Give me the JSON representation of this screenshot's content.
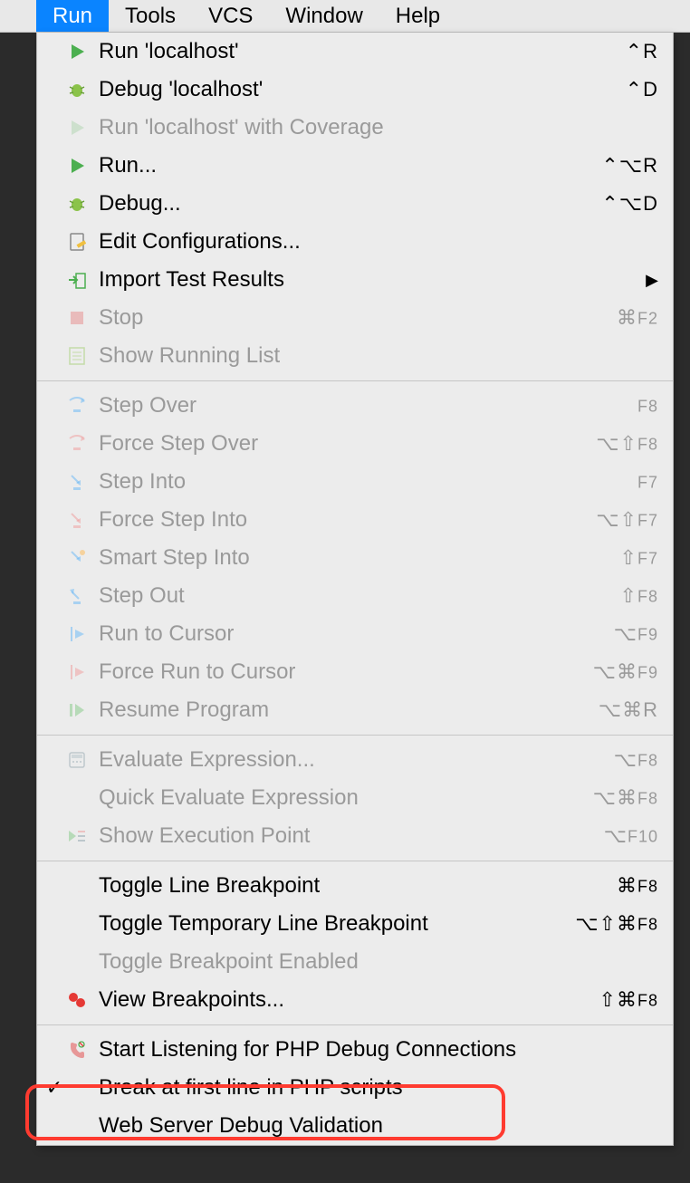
{
  "menubar": {
    "items": [
      "Run",
      "Tools",
      "VCS",
      "Window",
      "Help"
    ],
    "selected_index": 0
  },
  "menu": {
    "groups": [
      [
        {
          "icon": "play-green",
          "label": "Run 'localhost'",
          "shortcut": "⌃R",
          "disabled": false
        },
        {
          "icon": "bug-green",
          "label": "Debug 'localhost'",
          "shortcut": "⌃D",
          "disabled": false
        },
        {
          "icon": "play-faded",
          "label": "Run 'localhost' with Coverage",
          "shortcut": "",
          "disabled": true
        },
        {
          "icon": "play-green",
          "label": "Run...",
          "shortcut": "⌃⌥R",
          "disabled": false
        },
        {
          "icon": "bug-green",
          "label": "Debug...",
          "shortcut": "⌃⌥D",
          "disabled": false
        },
        {
          "icon": "edit-config",
          "label": "Edit Configurations...",
          "shortcut": "",
          "disabled": false
        },
        {
          "icon": "import",
          "label": "Import Test Results",
          "shortcut": "",
          "disabled": false,
          "submenu": true
        },
        {
          "icon": "stop-faded",
          "label": "Stop",
          "shortcut": "⌘F2",
          "disabled": true
        },
        {
          "icon": "list-faded",
          "label": "Show Running List",
          "shortcut": "",
          "disabled": true
        }
      ],
      [
        {
          "icon": "step-over",
          "label": "Step Over",
          "shortcut": "F8",
          "disabled": true
        },
        {
          "icon": "force-step-over",
          "label": "Force Step Over",
          "shortcut": "⌥⇧F8",
          "disabled": true
        },
        {
          "icon": "step-into",
          "label": "Step Into",
          "shortcut": "F7",
          "disabled": true
        },
        {
          "icon": "force-step-into",
          "label": "Force Step Into",
          "shortcut": "⌥⇧F7",
          "disabled": true
        },
        {
          "icon": "smart-step-into",
          "label": "Smart Step Into",
          "shortcut": "⇧F7",
          "disabled": true
        },
        {
          "icon": "step-out",
          "label": "Step Out",
          "shortcut": "⇧F8",
          "disabled": true
        },
        {
          "icon": "run-cursor",
          "label": "Run to Cursor",
          "shortcut": "⌥F9",
          "disabled": true
        },
        {
          "icon": "force-run-cursor",
          "label": "Force Run to Cursor",
          "shortcut": "⌥⌘F9",
          "disabled": true
        },
        {
          "icon": "resume",
          "label": "Resume Program",
          "shortcut": "⌥⌘R",
          "disabled": true
        }
      ],
      [
        {
          "icon": "calc",
          "label": "Evaluate Expression...",
          "shortcut": "⌥F8",
          "disabled": true
        },
        {
          "icon": "",
          "label": "Quick Evaluate Expression",
          "shortcut": "⌥⌘F8",
          "disabled": true
        },
        {
          "icon": "exec-point",
          "label": "Show Execution Point",
          "shortcut": "⌥F10",
          "disabled": true
        }
      ],
      [
        {
          "icon": "",
          "label": "Toggle Line Breakpoint",
          "shortcut": "⌘F8",
          "disabled": false
        },
        {
          "icon": "",
          "label": "Toggle Temporary Line Breakpoint",
          "shortcut": "⌥⇧⌘F8",
          "disabled": false
        },
        {
          "icon": "",
          "label": "Toggle Breakpoint Enabled",
          "shortcut": "",
          "disabled": true
        },
        {
          "icon": "breakpoints",
          "label": "View Breakpoints...",
          "shortcut": "⇧⌘F8",
          "disabled": false
        }
      ],
      [
        {
          "icon": "phone",
          "label": "Start Listening for PHP Debug Connections",
          "shortcut": "",
          "disabled": false
        },
        {
          "icon": "",
          "label": "Break at first line in PHP scripts",
          "shortcut": "",
          "disabled": false,
          "checked": true
        },
        {
          "icon": "",
          "label": "Web Server Debug Validation",
          "shortcut": "",
          "disabled": false
        }
      ]
    ]
  }
}
